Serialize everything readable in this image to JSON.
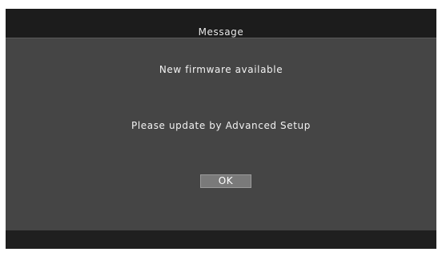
{
  "dialog": {
    "title": "Message",
    "line1": "New firmware available",
    "line2": "Please update by Advanced Setup",
    "ok_label": "OK"
  },
  "colors": {
    "background": "#1f1f1f",
    "panel": "#454545",
    "button": "#7a7a7a",
    "text": "#f2f2f2"
  }
}
